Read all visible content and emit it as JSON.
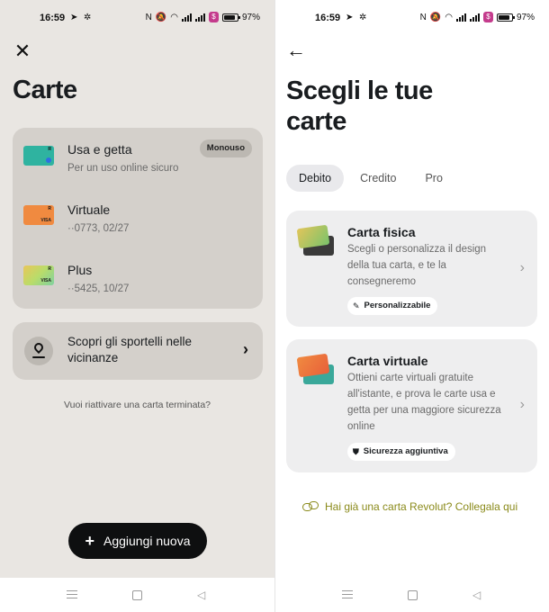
{
  "status_bar": {
    "time": "16:59",
    "battery": "97%"
  },
  "left": {
    "title": "Carte",
    "cards": [
      {
        "name": "Usa e getta",
        "sub": "Per un uso online sicuro",
        "badge": "Monouso",
        "color": "#2fb3a0"
      },
      {
        "name": "Virtuale",
        "sub": "··0773, 02/27",
        "color": "#f08a40"
      },
      {
        "name": "Plus",
        "sub": "··5425, 10/27",
        "color": "#c9d85a"
      }
    ],
    "card_mark_r": "R",
    "card_mark_visa": "VISA",
    "atm": {
      "label": "Scopri gli sportelli nelle vicinanze",
      "icon": "map-pin-icon"
    },
    "reactivate": "Vuoi riattivare una carta terminata?",
    "add_button": "Aggiungi nuova"
  },
  "right": {
    "title": "Scegli le tue carte",
    "tabs": [
      "Debito",
      "Credito",
      "Pro"
    ],
    "active_tab": "Debito",
    "offers": [
      {
        "title": "Carta fisica",
        "desc": "Scegli o personalizza il design della tua carta, e te la consegneremo",
        "badge": "Personalizzabile",
        "badge_icon": "brush-icon"
      },
      {
        "title": "Carta virtuale",
        "desc": "Ottieni carte virtuali gratuite all'istante, e prova le carte usa e getta per una maggiore sicurezza online",
        "badge": "Sicurezza aggiuntiva",
        "badge_icon": "shield-icon"
      }
    ],
    "link": "Hai già una carta Revolut? Collegala qui"
  },
  "colors": {
    "accent_link": "#8a8a1a",
    "left_bg": "#e9e6e2",
    "panel_bg": "#d4d0cb",
    "button_bg": "#0e0f10"
  }
}
